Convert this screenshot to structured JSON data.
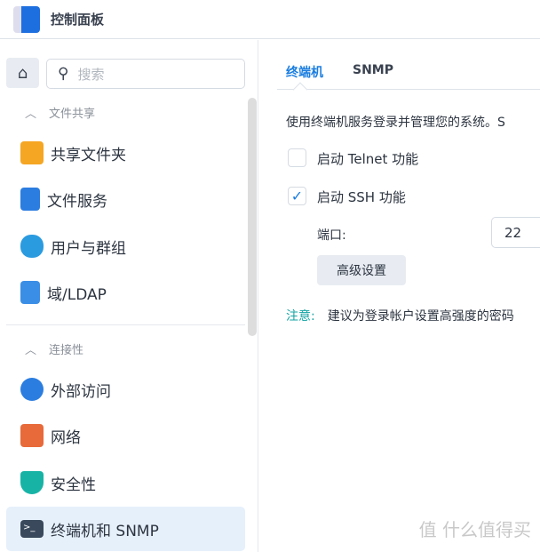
{
  "window": {
    "title": "控制面板"
  },
  "sidebar": {
    "search_placeholder": "搜索",
    "sections": [
      {
        "label": "文件共享"
      },
      {
        "label": "连接性"
      }
    ],
    "items": [
      {
        "label": "共享文件夹",
        "color": "#f5a623"
      },
      {
        "label": "文件服务",
        "color": "#2b7de0"
      },
      {
        "label": "用户与群组",
        "color": "#2b9be0"
      },
      {
        "label": "域/LDAP",
        "color": "#3a8ee6"
      },
      {
        "label": "外部访问",
        "color": "#2b7de0"
      },
      {
        "label": "网络",
        "color": "#e86a3a"
      },
      {
        "label": "安全性",
        "color": "#17b4a6"
      },
      {
        "label": "终端机和 SNMP",
        "color": "#3a4a5c"
      }
    ]
  },
  "main": {
    "tabs": [
      {
        "label": "终端机"
      },
      {
        "label": "SNMP"
      }
    ],
    "description": "使用终端机服务登录并管理您的系统。S",
    "telnet_label": "启动 Telnet 功能",
    "telnet_checked": false,
    "ssh_label": "启动 SSH 功能",
    "ssh_checked": true,
    "port_label": "端口:",
    "port_value": "22",
    "advanced_button": "高级设置",
    "note_label": "注意:",
    "note_text": "建议为登录帐户设置高强度的密码"
  },
  "watermark": "值 什么值得买"
}
